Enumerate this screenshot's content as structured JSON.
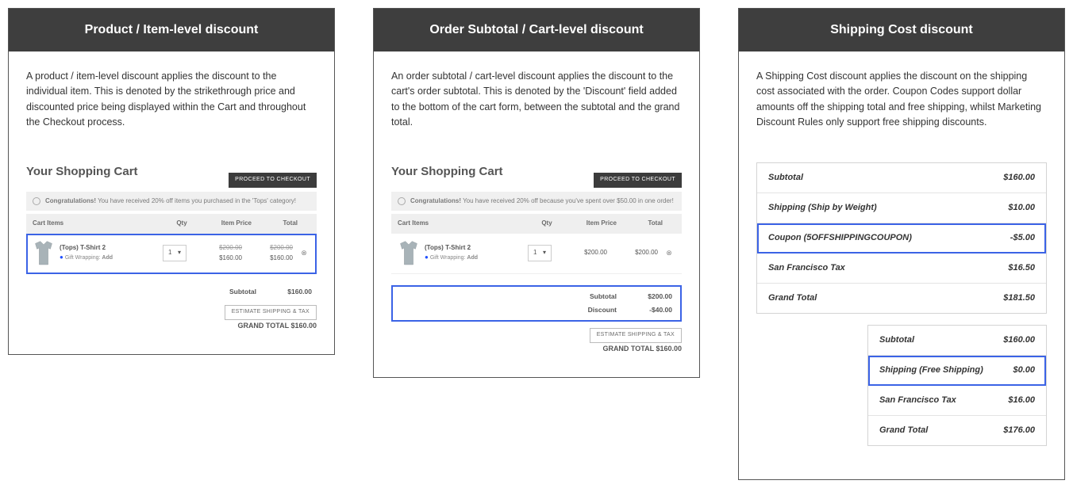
{
  "cards": {
    "product": {
      "title": "Product / Item-level discount",
      "desc": "A product / item-level discount applies the discount to the individual item. This is denoted by the strikethrough price and discounted price being displayed within the Cart and throughout the Checkout process.",
      "cart": {
        "heading": "Your Shopping Cart",
        "checkout_btn": "PROCEED TO CHECKOUT",
        "congrats_prefix": "Congratulations!",
        "congrats_msg": " You have received 20% off items you purchased in the 'Tops' category!",
        "cols": {
          "items": "Cart Items",
          "qty": "Qty",
          "price": "Item Price",
          "total": "Total"
        },
        "item": {
          "name": "(Tops) T-Shirt 2",
          "tag_action": "Gift Wrapping:",
          "tag_link": "Add",
          "qty": "1",
          "price_orig": "$200.00",
          "price_disc": "$160.00",
          "total_orig": "$200.00",
          "total_disc": "$160.00"
        },
        "subtotal_lbl": "Subtotal",
        "subtotal_val": "$160.00",
        "estimate_btn": "ESTIMATE SHIPPING & TAX",
        "grand_lbl": "GRAND TOTAL",
        "grand_val": "$160.00"
      }
    },
    "order": {
      "title": "Order Subtotal / Cart-level discount",
      "desc": "An order subtotal / cart-level discount applies the discount to the cart's order subtotal. This is denoted by the 'Discount' field added to the bottom of the cart form, between the subtotal and the grand total.",
      "cart": {
        "heading": "Your Shopping Cart",
        "checkout_btn": "PROCEED TO CHECKOUT",
        "congrats_prefix": "Congratulations!",
        "congrats_msg": " You have received 20% off because you've spent over $50.00 in one order!",
        "cols": {
          "items": "Cart Items",
          "qty": "Qty",
          "price": "Item Price",
          "total": "Total"
        },
        "item": {
          "name": "(Tops) T-Shirt 2",
          "tag_action": "Gift Wrapping:",
          "tag_link": "Add",
          "qty": "1",
          "price": "$200.00",
          "total": "$200.00"
        },
        "subtotal_lbl": "Subtotal",
        "subtotal_val": "$200.00",
        "discount_lbl": "Discount",
        "discount_val": "-$40.00",
        "estimate_btn": "ESTIMATE SHIPPING & TAX",
        "grand_lbl": "GRAND TOTAL",
        "grand_val": "$160.00"
      }
    },
    "shipping": {
      "title": "Shipping Cost discount",
      "desc": "A Shipping Cost discount applies the discount on the shipping cost associated with the order. Coupon Codes support dollar amounts off the shipping total and free shipping, whilst Marketing Discount Rules only support free shipping discounts.",
      "summary_a": {
        "rows": [
          {
            "lbl": "Subtotal",
            "val": "$160.00",
            "hl": false
          },
          {
            "lbl": "Shipping (Ship by Weight)",
            "val": "$10.00",
            "hl": false
          },
          {
            "lbl": "Coupon (5OFFSHIPPINGCOUPON)",
            "val": "-$5.00",
            "hl": true
          },
          {
            "lbl": "San Francisco Tax",
            "val": "$16.50",
            "hl": false
          },
          {
            "lbl": "Grand Total",
            "val": "$181.50",
            "hl": false
          }
        ]
      },
      "summary_b": {
        "rows": [
          {
            "lbl": "Subtotal",
            "val": "$160.00",
            "hl": false
          },
          {
            "lbl": "Shipping (Free Shipping)",
            "val": "$0.00",
            "hl": true
          },
          {
            "lbl": "San Francisco Tax",
            "val": "$16.00",
            "hl": false
          },
          {
            "lbl": "Grand Total",
            "val": "$176.00",
            "hl": false
          }
        ]
      }
    }
  }
}
